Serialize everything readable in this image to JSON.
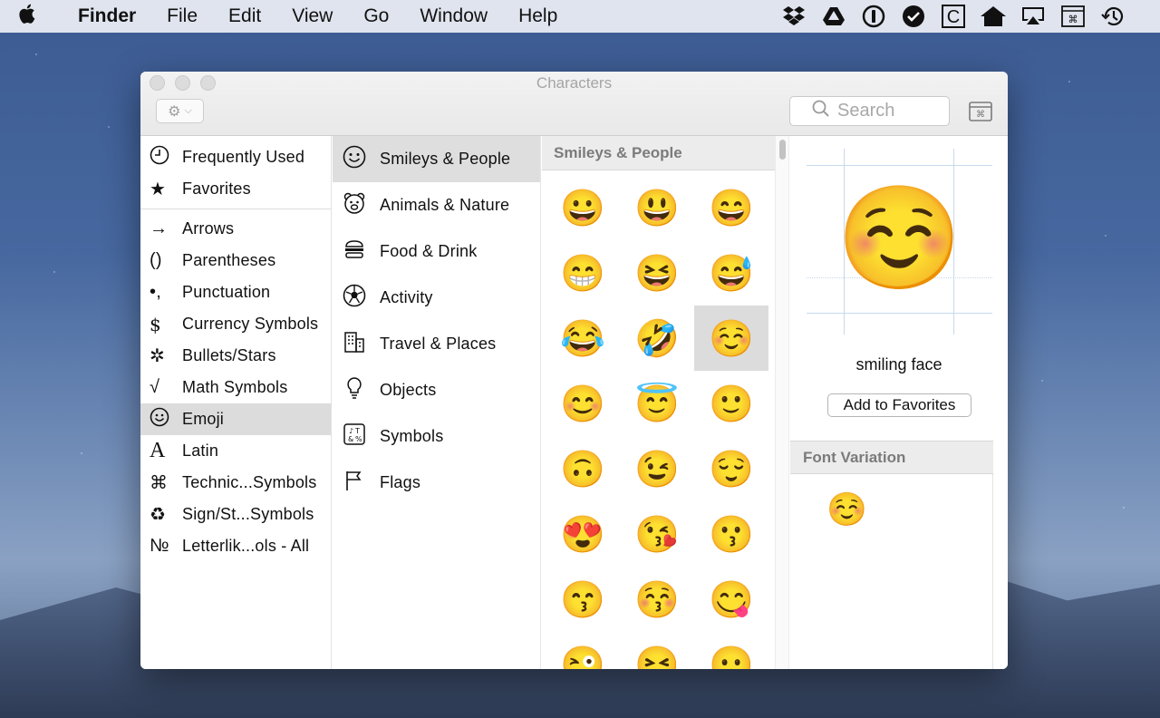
{
  "menubar": {
    "apple_icon": "apple-logo-icon",
    "app_name": "Finder",
    "menus": [
      "File",
      "Edit",
      "View",
      "Go",
      "Window",
      "Help"
    ],
    "status_icons": [
      "dropbox-icon",
      "google-drive-icon",
      "1password-icon",
      "checkmark-circle-icon",
      "c-box-icon",
      "house-icon",
      "airplay-icon",
      "keyboard-viewer-icon",
      "time-machine-icon"
    ]
  },
  "window": {
    "title": "Characters",
    "search_placeholder": "Search"
  },
  "categories": [
    {
      "label": "Frequently Used",
      "icon": "clock-icon",
      "glyph": "🕘"
    },
    {
      "label": "Favorites",
      "icon": "star-icon",
      "glyph": "★"
    },
    {
      "label": "Arrows",
      "icon": "arrow-icon",
      "glyph": "→"
    },
    {
      "label": "Parentheses",
      "icon": "parentheses-icon",
      "glyph": "()"
    },
    {
      "label": "Punctuation",
      "icon": "punctuation-icon",
      "glyph": "•,"
    },
    {
      "label": "Currency Symbols",
      "icon": "dollar-icon",
      "glyph": "$"
    },
    {
      "label": "Bullets/Stars",
      "icon": "asterisk-icon",
      "glyph": "✲"
    },
    {
      "label": "Math Symbols",
      "icon": "sqrt-icon",
      "glyph": "√"
    },
    {
      "label": "Emoji",
      "icon": "smiley-icon",
      "glyph": "☺"
    },
    {
      "label": "Latin",
      "icon": "latin-a-icon",
      "glyph": "A"
    },
    {
      "label": "Technic...Symbols",
      "icon": "command-icon",
      "glyph": "⌘"
    },
    {
      "label": "Sign/St...Symbols",
      "icon": "recycle-icon",
      "glyph": "♻"
    },
    {
      "label": "Letterlik...ols - All",
      "icon": "numero-icon",
      "glyph": "№"
    }
  ],
  "subcategories": [
    {
      "label": "Smileys & People",
      "icon": "smiley-icon",
      "glyph": "☺"
    },
    {
      "label": "Animals & Nature",
      "icon": "bear-icon",
      "glyph": "🐻"
    },
    {
      "label": "Food & Drink",
      "icon": "burger-icon",
      "glyph": "🍔"
    },
    {
      "label": "Activity",
      "icon": "soccer-ball-icon",
      "glyph": "⚽"
    },
    {
      "label": "Travel & Places",
      "icon": "building-icon",
      "glyph": "🏢"
    },
    {
      "label": "Objects",
      "icon": "lightbulb-icon",
      "glyph": "💡"
    },
    {
      "label": "Symbols",
      "icon": "symbols-icon",
      "glyph": "🔣"
    },
    {
      "label": "Flags",
      "icon": "flag-icon",
      "glyph": "⚐"
    }
  ],
  "grid": {
    "header": "Smileys & People",
    "emojis": [
      "😀",
      "😃",
      "😄",
      "😁",
      "😆",
      "😅",
      "😂",
      "🤣",
      "☺️",
      "😊",
      "😇",
      "🙂",
      "🙃",
      "😉",
      "😌",
      "😍",
      "😘",
      "😗",
      "😙",
      "😚",
      "😋",
      "😜",
      "😝",
      "😛"
    ]
  },
  "detail": {
    "glyph": "☺️",
    "name": "smiling face",
    "add_favorites_label": "Add to Favorites",
    "font_variation_header": "Font Variation",
    "variation_glyph": "☺️"
  }
}
